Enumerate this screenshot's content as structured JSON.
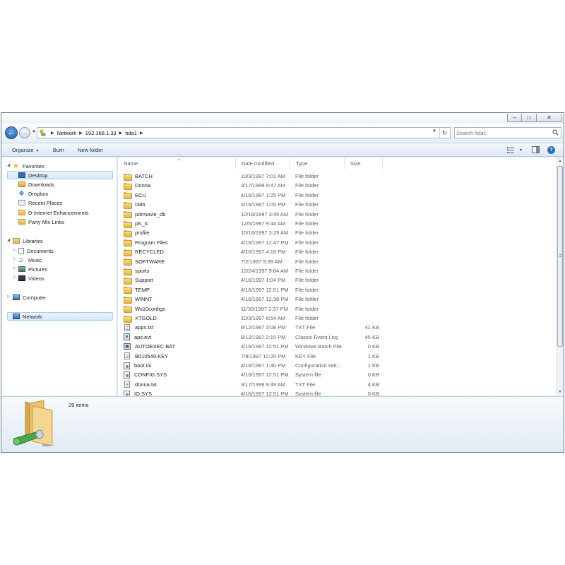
{
  "window": {
    "minimize": "–",
    "maximize": "□",
    "close": "✕"
  },
  "address": {
    "crumbs": [
      "Network",
      "192.168.1.33",
      "hda1"
    ]
  },
  "search": {
    "placeholder": "Search hda1"
  },
  "toolbar": {
    "organize": "Organize",
    "burn": "Burn",
    "new_folder": "New folder",
    "help": "?"
  },
  "nav": {
    "favorites": {
      "label": "Favorites",
      "items": [
        "Desktop",
        "Downloads",
        "Dropbox",
        "Recent Places",
        "D-Internet Enhancements",
        "Party Mix Links"
      ]
    },
    "libraries": {
      "label": "Libraries",
      "items": [
        "Documents",
        "Music",
        "Pictures",
        "Videos"
      ]
    },
    "computer": "Computer",
    "network": "Network"
  },
  "columns": {
    "name": "Name",
    "date": "Date modified",
    "type": "Type",
    "size": "Size"
  },
  "files": [
    {
      "name": "BATCH",
      "date": "10/3/1997 7:01 AM",
      "type": "File folder",
      "size": "",
      "icon": "folder"
    },
    {
      "name": "Donna",
      "date": "3/17/1998 9:47 AM",
      "type": "File folder",
      "size": "",
      "icon": "folder"
    },
    {
      "name": "ECU",
      "date": "4/16/1997 1:25 PM",
      "type": "File folder",
      "size": "",
      "icon": "folder"
    },
    {
      "name": "I386",
      "date": "4/16/1997 1:05 PM",
      "type": "File folder",
      "size": "",
      "icon": "folder"
    },
    {
      "name": "pdrmovie_db",
      "date": "10/18/1997 3:45 AM",
      "type": "File folder",
      "size": "",
      "icon": "folder"
    },
    {
      "name": "pls_lc",
      "date": "12/5/1997 9:44 AM",
      "type": "File folder",
      "size": "",
      "icon": "folder"
    },
    {
      "name": "profile",
      "date": "10/18/1997 3:29 AM",
      "type": "File folder",
      "size": "",
      "icon": "folder"
    },
    {
      "name": "Program Files",
      "date": "4/16/1997 12:47 PM",
      "type": "File folder",
      "size": "",
      "icon": "folder"
    },
    {
      "name": "RECYCLED",
      "date": "4/16/1997 4:16 PM",
      "type": "File folder",
      "size": "",
      "icon": "folder"
    },
    {
      "name": "SOFTWARE",
      "date": "7/2/1997 9:39 AM",
      "type": "File folder",
      "size": "",
      "icon": "folder"
    },
    {
      "name": "sports",
      "date": "12/24/1997 9:04 AM",
      "type": "File folder",
      "size": "",
      "icon": "folder"
    },
    {
      "name": "Support",
      "date": "4/16/1997 1:04 PM",
      "type": "File folder",
      "size": "",
      "icon": "folder"
    },
    {
      "name": "TEMP",
      "date": "4/16/1997 12:51 PM",
      "type": "File folder",
      "size": "",
      "icon": "folder"
    },
    {
      "name": "WINNT",
      "date": "4/16/1997 12:38 PM",
      "type": "File folder",
      "size": "",
      "icon": "folder"
    },
    {
      "name": "Ws10configs",
      "date": "11/30/1997 2:37 PM",
      "type": "File folder",
      "size": "",
      "icon": "folder"
    },
    {
      "name": "XTGOLD",
      "date": "10/3/1997 6:54 AM",
      "type": "File folder",
      "size": "",
      "icon": "folder"
    },
    {
      "name": "apps.txt",
      "date": "8/12/1997 3:08 PM",
      "type": "TXT File",
      "size": "41 KB",
      "icon": "file"
    },
    {
      "name": "aps.evt",
      "date": "8/12/1997 2:15 PM",
      "type": "Classic Event Log",
      "size": "45 KB",
      "icon": "evt"
    },
    {
      "name": "AUTOEXEC.BAT",
      "date": "4/16/1997 12:51 PM",
      "type": "Windows Batch File",
      "size": "0 KB",
      "icon": "bat"
    },
    {
      "name": "B010549.KEY",
      "date": "7/9/1997 12:20 PM",
      "type": "KEY File",
      "size": "1 KB",
      "icon": "file"
    },
    {
      "name": "boot.ini",
      "date": "4/16/1997 1:40 PM",
      "type": "Configuration sett...",
      "size": "1 KB",
      "icon": "ini"
    },
    {
      "name": "CONFIG.SYS",
      "date": "4/16/1997 12:51 PM",
      "type": "System file",
      "size": "0 KB",
      "icon": "ini"
    },
    {
      "name": "donna.txt",
      "date": "3/17/1998 9:49 AM",
      "type": "TXT File",
      "size": "4 KB",
      "icon": "file"
    },
    {
      "name": "IO.SYS",
      "date": "4/16/1997 12:51 PM",
      "type": "System file",
      "size": "0 KB",
      "icon": "ini"
    }
  ],
  "details": {
    "count": "29 items"
  }
}
